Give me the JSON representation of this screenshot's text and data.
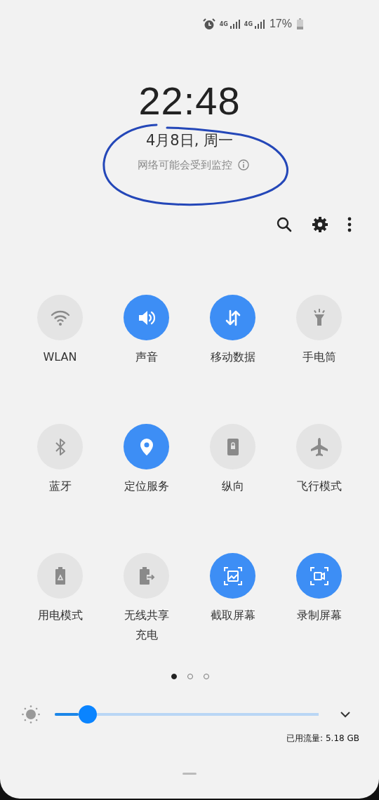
{
  "status_bar": {
    "network_1": "4G",
    "network_2": "4G",
    "battery": "17%"
  },
  "lock_info": {
    "time": "22:48",
    "date": "4月8日, 周一",
    "notice": "网络可能会受到监控"
  },
  "tiles": [
    {
      "label": "WLAN",
      "on": false
    },
    {
      "label": "声音",
      "on": true
    },
    {
      "label": "移动数据",
      "on": true
    },
    {
      "label": "手电筒",
      "on": false
    },
    {
      "label": "蓝牙",
      "on": false
    },
    {
      "label": "定位服务",
      "on": true
    },
    {
      "label": "纵向",
      "on": false
    },
    {
      "label": "飞行模式",
      "on": false
    },
    {
      "label": "用电模式",
      "on": false
    },
    {
      "label": "无线共享充电",
      "on": false
    },
    {
      "label": "截取屏幕",
      "on": true
    },
    {
      "label": "录制屏幕",
      "on": true
    }
  ],
  "pages": [
    {
      "selected": true
    },
    {
      "selected": false
    },
    {
      "selected": false
    }
  ],
  "brightness": {
    "level": 0.09
  },
  "data_usage": "已用流量: 5.18 GB"
}
